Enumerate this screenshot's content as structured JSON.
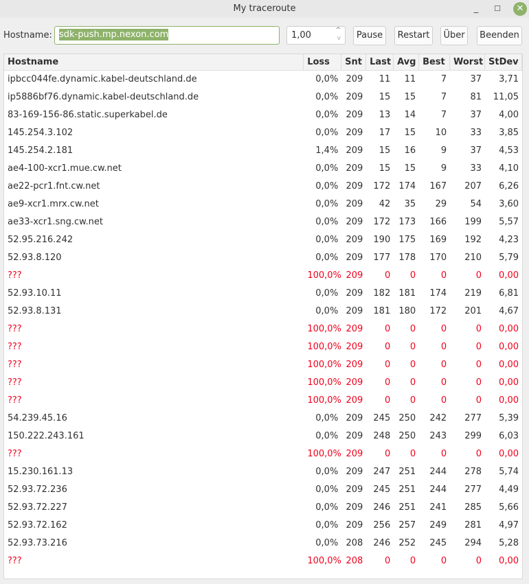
{
  "window": {
    "title": "My traceroute",
    "minimize": "_",
    "maximize": "☐",
    "close": "✕"
  },
  "toolbar": {
    "hostname_label": "Hostname:",
    "hostname_value": "sdk-push.mp.nexon.com",
    "interval_value": "1,00",
    "pause": "Pause",
    "restart": "Restart",
    "about": "Über",
    "quit": "Beenden"
  },
  "table": {
    "columns": [
      "Hostname",
      "Loss",
      "Snt",
      "Last",
      "Avg",
      "Best",
      "Worst",
      "StDev"
    ],
    "rows": [
      [
        "ipbcc044fe.dynamic.kabel-deutschland.de",
        "0,0%",
        "209",
        "11",
        "11",
        "7",
        "37",
        "3,71"
      ],
      [
        "ip5886bf76.dynamic.kabel-deutschland.de",
        "0,0%",
        "209",
        "15",
        "15",
        "7",
        "81",
        "11,05"
      ],
      [
        "83-169-156-86.static.superkabel.de",
        "0,0%",
        "209",
        "13",
        "14",
        "7",
        "37",
        "4,00"
      ],
      [
        "145.254.3.102",
        "0,0%",
        "209",
        "17",
        "15",
        "10",
        "33",
        "3,85"
      ],
      [
        "145.254.2.181",
        "1,4%",
        "209",
        "15",
        "16",
        "9",
        "37",
        "4,53"
      ],
      [
        "ae4-100-xcr1.mue.cw.net",
        "0,0%",
        "209",
        "15",
        "15",
        "9",
        "33",
        "4,10"
      ],
      [
        "ae22-pcr1.fnt.cw.net",
        "0,0%",
        "209",
        "172",
        "174",
        "167",
        "207",
        "6,26"
      ],
      [
        "ae9-xcr1.mrx.cw.net",
        "0,0%",
        "209",
        "42",
        "35",
        "29",
        "54",
        "3,60"
      ],
      [
        "ae33-xcr1.sng.cw.net",
        "0,0%",
        "209",
        "172",
        "173",
        "166",
        "199",
        "5,57"
      ],
      [
        "52.95.216.242",
        "0,0%",
        "209",
        "190",
        "175",
        "169",
        "192",
        "4,23"
      ],
      [
        "52.93.8.120",
        "0,0%",
        "209",
        "177",
        "178",
        "170",
        "210",
        "5,79"
      ],
      [
        "???",
        "100,0%",
        "209",
        "0",
        "0",
        "0",
        "0",
        "0,00"
      ],
      [
        "52.93.10.11",
        "0,0%",
        "209",
        "182",
        "181",
        "174",
        "219",
        "6,81"
      ],
      [
        "52.93.8.131",
        "0,0%",
        "209",
        "181",
        "180",
        "172",
        "201",
        "4,67"
      ],
      [
        "???",
        "100,0%",
        "209",
        "0",
        "0",
        "0",
        "0",
        "0,00"
      ],
      [
        "???",
        "100,0%",
        "209",
        "0",
        "0",
        "0",
        "0",
        "0,00"
      ],
      [
        "???",
        "100,0%",
        "209",
        "0",
        "0",
        "0",
        "0",
        "0,00"
      ],
      [
        "???",
        "100,0%",
        "209",
        "0",
        "0",
        "0",
        "0",
        "0,00"
      ],
      [
        "???",
        "100,0%",
        "209",
        "0",
        "0",
        "0",
        "0",
        "0,00"
      ],
      [
        "54.239.45.16",
        "0,0%",
        "209",
        "245",
        "250",
        "242",
        "277",
        "5,39"
      ],
      [
        "150.222.243.161",
        "0,0%",
        "209",
        "248",
        "250",
        "243",
        "299",
        "6,03"
      ],
      [
        "???",
        "100,0%",
        "209",
        "0",
        "0",
        "0",
        "0",
        "0,00"
      ],
      [
        "15.230.161.13",
        "0,0%",
        "209",
        "247",
        "251",
        "244",
        "278",
        "5,74"
      ],
      [
        "52.93.72.236",
        "0,0%",
        "209",
        "245",
        "251",
        "244",
        "277",
        "4,49"
      ],
      [
        "52.93.72.227",
        "0,0%",
        "209",
        "246",
        "251",
        "241",
        "285",
        "5,66"
      ],
      [
        "52.93.72.162",
        "0,0%",
        "209",
        "256",
        "257",
        "249",
        "281",
        "4,97"
      ],
      [
        "52.93.73.216",
        "0,0%",
        "208",
        "246",
        "252",
        "245",
        "294",
        "5,28"
      ],
      [
        "???",
        "100,0%",
        "208",
        "0",
        "0",
        "0",
        "0",
        "0,00"
      ]
    ]
  },
  "colors": {
    "accent": "#8eb26a",
    "loss_row": "#f0001c"
  }
}
